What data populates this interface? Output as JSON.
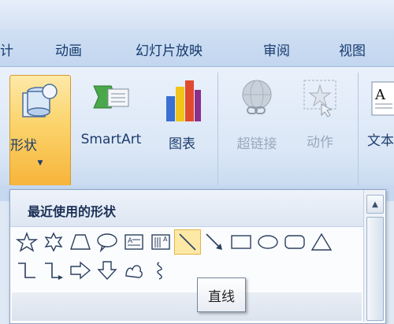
{
  "tabs": [
    "计",
    "动画",
    "幻灯片放映",
    "审阅",
    "视图"
  ],
  "ribbon": {
    "shapes_label": "形状",
    "shapes_arrow": "▼",
    "smartart_label": "SmartArt",
    "chart_label": "图表",
    "hyperlink_label": "超链接",
    "action_label": "动作",
    "textbox_label": "文本"
  },
  "dropdown": {
    "title": "最近使用的形状",
    "shapes_row1": [
      "star-5-point",
      "star-6-point",
      "trapezoid",
      "speech-bubble",
      "text-box",
      "vertical-text-box",
      "line",
      "arrow",
      "rectangle",
      "oval",
      "rounded-rectangle",
      "triangle"
    ],
    "shapes_row2": [
      "elbow-connector",
      "elbow-arrow-connector",
      "right-arrow",
      "down-arrow",
      "freeform",
      "curve"
    ],
    "selected": "line"
  },
  "tooltip": "直线",
  "colors": {
    "accent": "#f7b43a",
    "ribbon": "#dbe7f6",
    "text": "#1d3d6e"
  }
}
